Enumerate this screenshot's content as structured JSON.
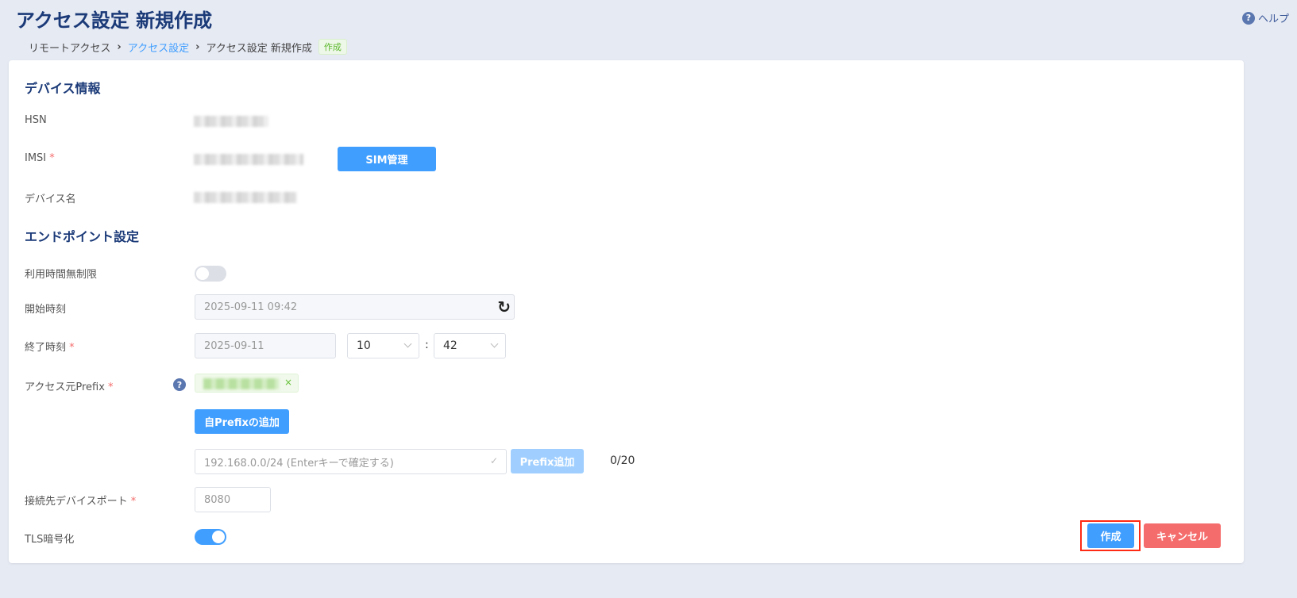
{
  "header": {
    "title": "アクセス設定 新規作成",
    "help_label": "ヘルプ"
  },
  "breadcrumb": {
    "items": [
      "リモートアクセス",
      "アクセス設定",
      "アクセス設定 新規作成"
    ],
    "badge": "作成"
  },
  "device": {
    "section_title": "デバイス情報",
    "hsn_label": "HSN",
    "imsi_label": "IMSI",
    "sim_button": "SIM管理",
    "name_label": "デバイス名"
  },
  "endpoint": {
    "section_title": "エンドポイント設定",
    "unlimited_label": "利用時間無制限",
    "unlimited_on": false,
    "start_label": "開始時刻",
    "start_value": "2025-09-11 09:42",
    "end_label": "終了時刻",
    "end_date": "2025-09-11",
    "end_hour": "10",
    "end_minute": "42",
    "time_sep": ":",
    "prefix_label": "アクセス元Prefix",
    "own_prefix_button": "自Prefixの追加",
    "prefix_placeholder": "192.168.0.0/24 (Enterキーで確定する)",
    "prefix_add_button": "Prefix追加",
    "prefix_count": "0/20",
    "port_label": "接続先デバイスポート",
    "port_placeholder": "8080",
    "tls_label": "TLS暗号化",
    "tls_on": true
  },
  "actions": {
    "create": "作成",
    "cancel": "キャンセル"
  },
  "required_mark": "*"
}
